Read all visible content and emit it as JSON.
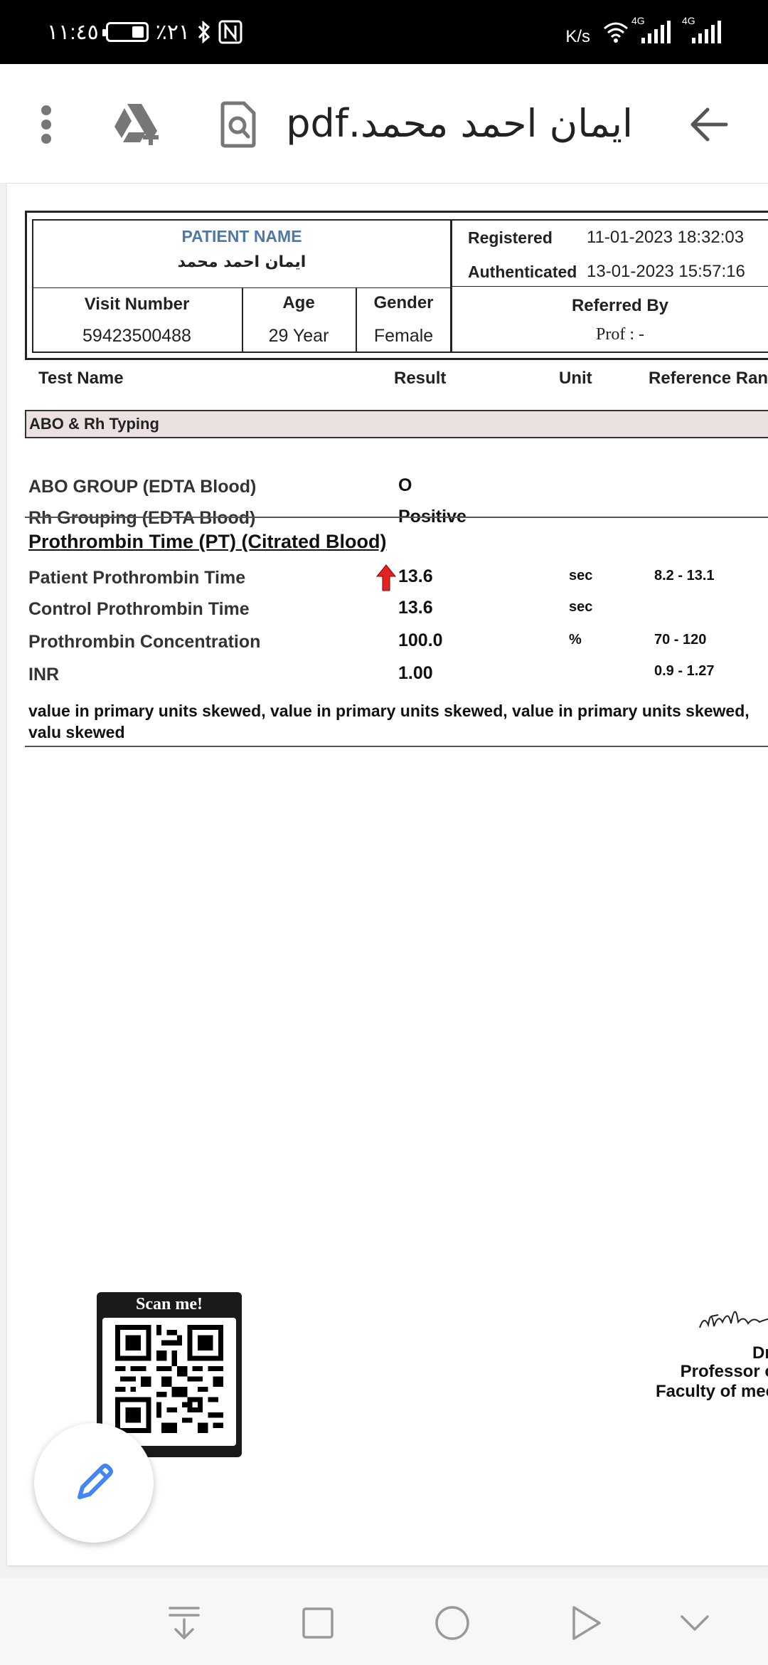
{
  "status_bar": {
    "time": "١١:٤٥",
    "battery": "٪٢١",
    "net_speed": "K/s",
    "net_label": "4G"
  },
  "toolbar": {
    "title": "ايمان احمد محمد.pdf",
    "back_icon": "arrow-left-icon",
    "search_icon": "document-search-icon",
    "drive_icon": "add-to-drive-icon",
    "menu_icon": "more-vert-icon"
  },
  "report": {
    "patient_name_label": "PATIENT NAME",
    "patient_name": "ايمان احمد محمد",
    "visit_number_label": "Visit Number",
    "visit_number": "59423500488",
    "age_label": "Age",
    "age": "29 Year",
    "gender_label": "Gender",
    "gender": "Female",
    "registered_label": "Registered",
    "registered": "11-01-2023 18:32:03",
    "authenticated_label": "Authenticated",
    "authenticated": "13-01-2023 15:57:16",
    "referred_by_label": "Referred By",
    "referred_by": "Prof : -",
    "columns": [
      "Test Name",
      "Result",
      "Unit",
      "Reference Ran"
    ],
    "section_abo": "ABO & Rh Typing",
    "abo_rows": [
      {
        "name": "ABO GROUP (EDTA Blood)",
        "result": "O"
      },
      {
        "name": "Rh Grouping (EDTA Blood)",
        "result": "Positive"
      }
    ],
    "section_pt": "Prothrombin Time (PT) (Citrated Blood)",
    "pt_rows": [
      {
        "name": "Patient Prothrombin Time",
        "result": "13.6",
        "unit": "sec",
        "ref": "8.2 - 13.1",
        "flag": "high"
      },
      {
        "name": "Control Prothrombin Time",
        "result": "13.6",
        "unit": "sec",
        "ref": ""
      },
      {
        "name": "Prothrombin Concentration",
        "result": "100.0",
        "unit": "%",
        "ref": "70 - 120"
      },
      {
        "name": "INR",
        "result": "1.00",
        "unit": "",
        "ref": "0.9 - 1.27"
      }
    ],
    "note": "value in primary units skewed, value in primary units skewed, value in primary units skewed, valu skewed",
    "qr_label": "Scan me!",
    "sig_line1": "Dr.",
    "sig_line2": "Professor o",
    "sig_line3": "Faculty of mec"
  },
  "fab": {
    "icon": "pencil-icon"
  },
  "nav": {
    "icons": [
      "download-icon",
      "square-icon",
      "circle-icon",
      "triangle-icon",
      "chevron-down-icon"
    ]
  },
  "colors": {
    "accent_blue": "#4285f4",
    "patient_label": "#4f78a5",
    "section_band": "#ece1e1",
    "flag_red": "#e32222"
  }
}
